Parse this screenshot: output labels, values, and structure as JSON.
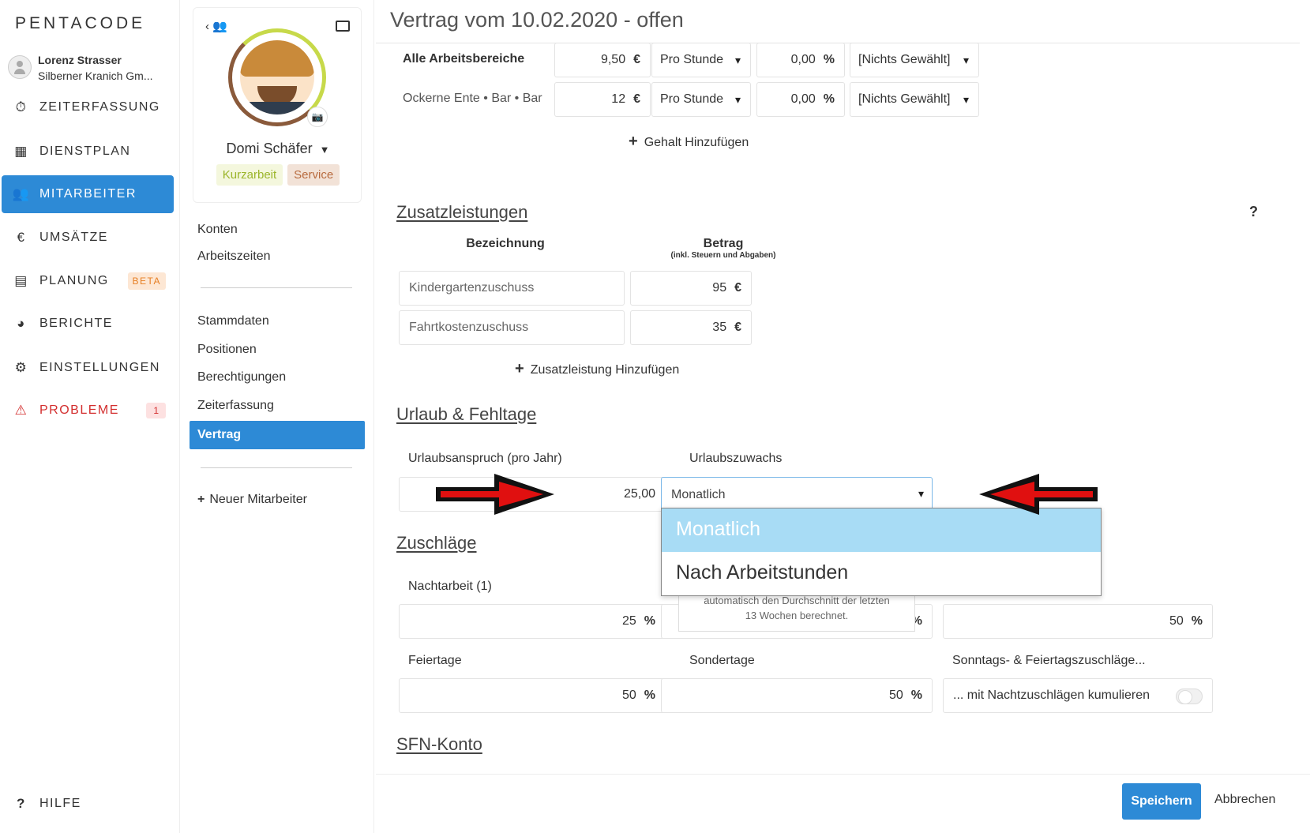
{
  "app": {
    "logo": "PENTACODE"
  },
  "user": {
    "name": "Lorenz Strasser",
    "company": "Silberner Kranich Gm..."
  },
  "nav": {
    "items": [
      {
        "label": "ZEITERFASSUNG",
        "icon": "stopwatch-icon"
      },
      {
        "label": "DIENSTPLAN",
        "icon": "table-icon"
      },
      {
        "label": "MITARBEITER",
        "icon": "users-icon"
      },
      {
        "label": "UMSÄTZE",
        "icon": "euro-icon"
      },
      {
        "label": "PLANUNG",
        "icon": "calendar-icon",
        "badge": "BETA"
      },
      {
        "label": "BERICHTE",
        "icon": "pie-chart-icon"
      },
      {
        "label": "EINSTELLUNGEN",
        "icon": "gear-icon"
      },
      {
        "label": "PROBLEME",
        "icon": "warning-icon",
        "badge": "1"
      }
    ],
    "help": "HILFE"
  },
  "profile": {
    "name": "Domi Schäfer",
    "tags": [
      "Kurzarbeit",
      "Service"
    ],
    "links_top": [
      "Konten",
      "Arbeitszeiten"
    ],
    "links_mid": [
      "Stammdaten",
      "Positionen",
      "Berechtigungen",
      "Zeiterfassung",
      "Vertrag"
    ],
    "new_employee": "Neuer Mitarbeiter"
  },
  "contract": {
    "title": "Vertrag vom 10.02.2020 - offen",
    "salary_rows": [
      {
        "area": "Alle Arbeitsbereiche",
        "amount": "9,50",
        "currency": "€",
        "period": "Pro Stunde",
        "percent": "0,00",
        "pct_unit": "%",
        "choice": "[Nichts Gewählt]"
      },
      {
        "area": "Ockerne Ente • Bar • Bar",
        "amount": "12",
        "currency": "€",
        "period": "Pro Stunde",
        "percent": "0,00",
        "pct_unit": "%",
        "choice": "[Nichts Gewählt]"
      }
    ],
    "add_salary": "Gehalt Hinzufügen",
    "benefits": {
      "heading": "Zusatzleistungen",
      "help": "?",
      "col_name": "Bezeichnung",
      "col_amount": "Betrag",
      "col_amount_sub": "(inkl. Steuern und Abgaben)",
      "rows": [
        {
          "name": "Kindergartenzuschuss",
          "amount": "95",
          "unit": "€"
        },
        {
          "name": "Fahrtkostenzuschuss",
          "amount": "35",
          "unit": "€"
        }
      ],
      "add": "Zusatzleistung Hinzufügen"
    },
    "vacation": {
      "heading": "Urlaub & Fehltage",
      "entitlement_label": "Urlaubsanspruch (pro Jahr)",
      "entitlement_value": "25,00",
      "accrual_label": "Urlaubszuwachs",
      "accrual_value": "Monatlich",
      "options": [
        "Monatlich",
        "Nach Arbeitstunden"
      ]
    },
    "surcharges": {
      "heading": "Zuschläge",
      "night_label": "Nachtarbeit (1)",
      "night_value": "25",
      "tooltip_line1": "automatisch den Durchschnitt der letzten",
      "tooltip_line2": "13 Wochen berechnet.",
      "mid_unit": "%",
      "right_value": "50",
      "holiday_label": "Feiertage",
      "holiday_value": "50",
      "special_label": "Sondertage",
      "special_value": "50",
      "sunday_label": "Sonntags- & Feiertagszuschläge...",
      "cumulate_label": "... mit Nachtzuschlägen kumulieren",
      "unit": "%"
    },
    "sfn_heading": "SFN-Konto",
    "save": "Speichern",
    "cancel": "Abbrechen"
  },
  "colors": {
    "accent": "#2d8ad6",
    "danger": "#d32f2f",
    "highlight": "#a8dcf5"
  }
}
